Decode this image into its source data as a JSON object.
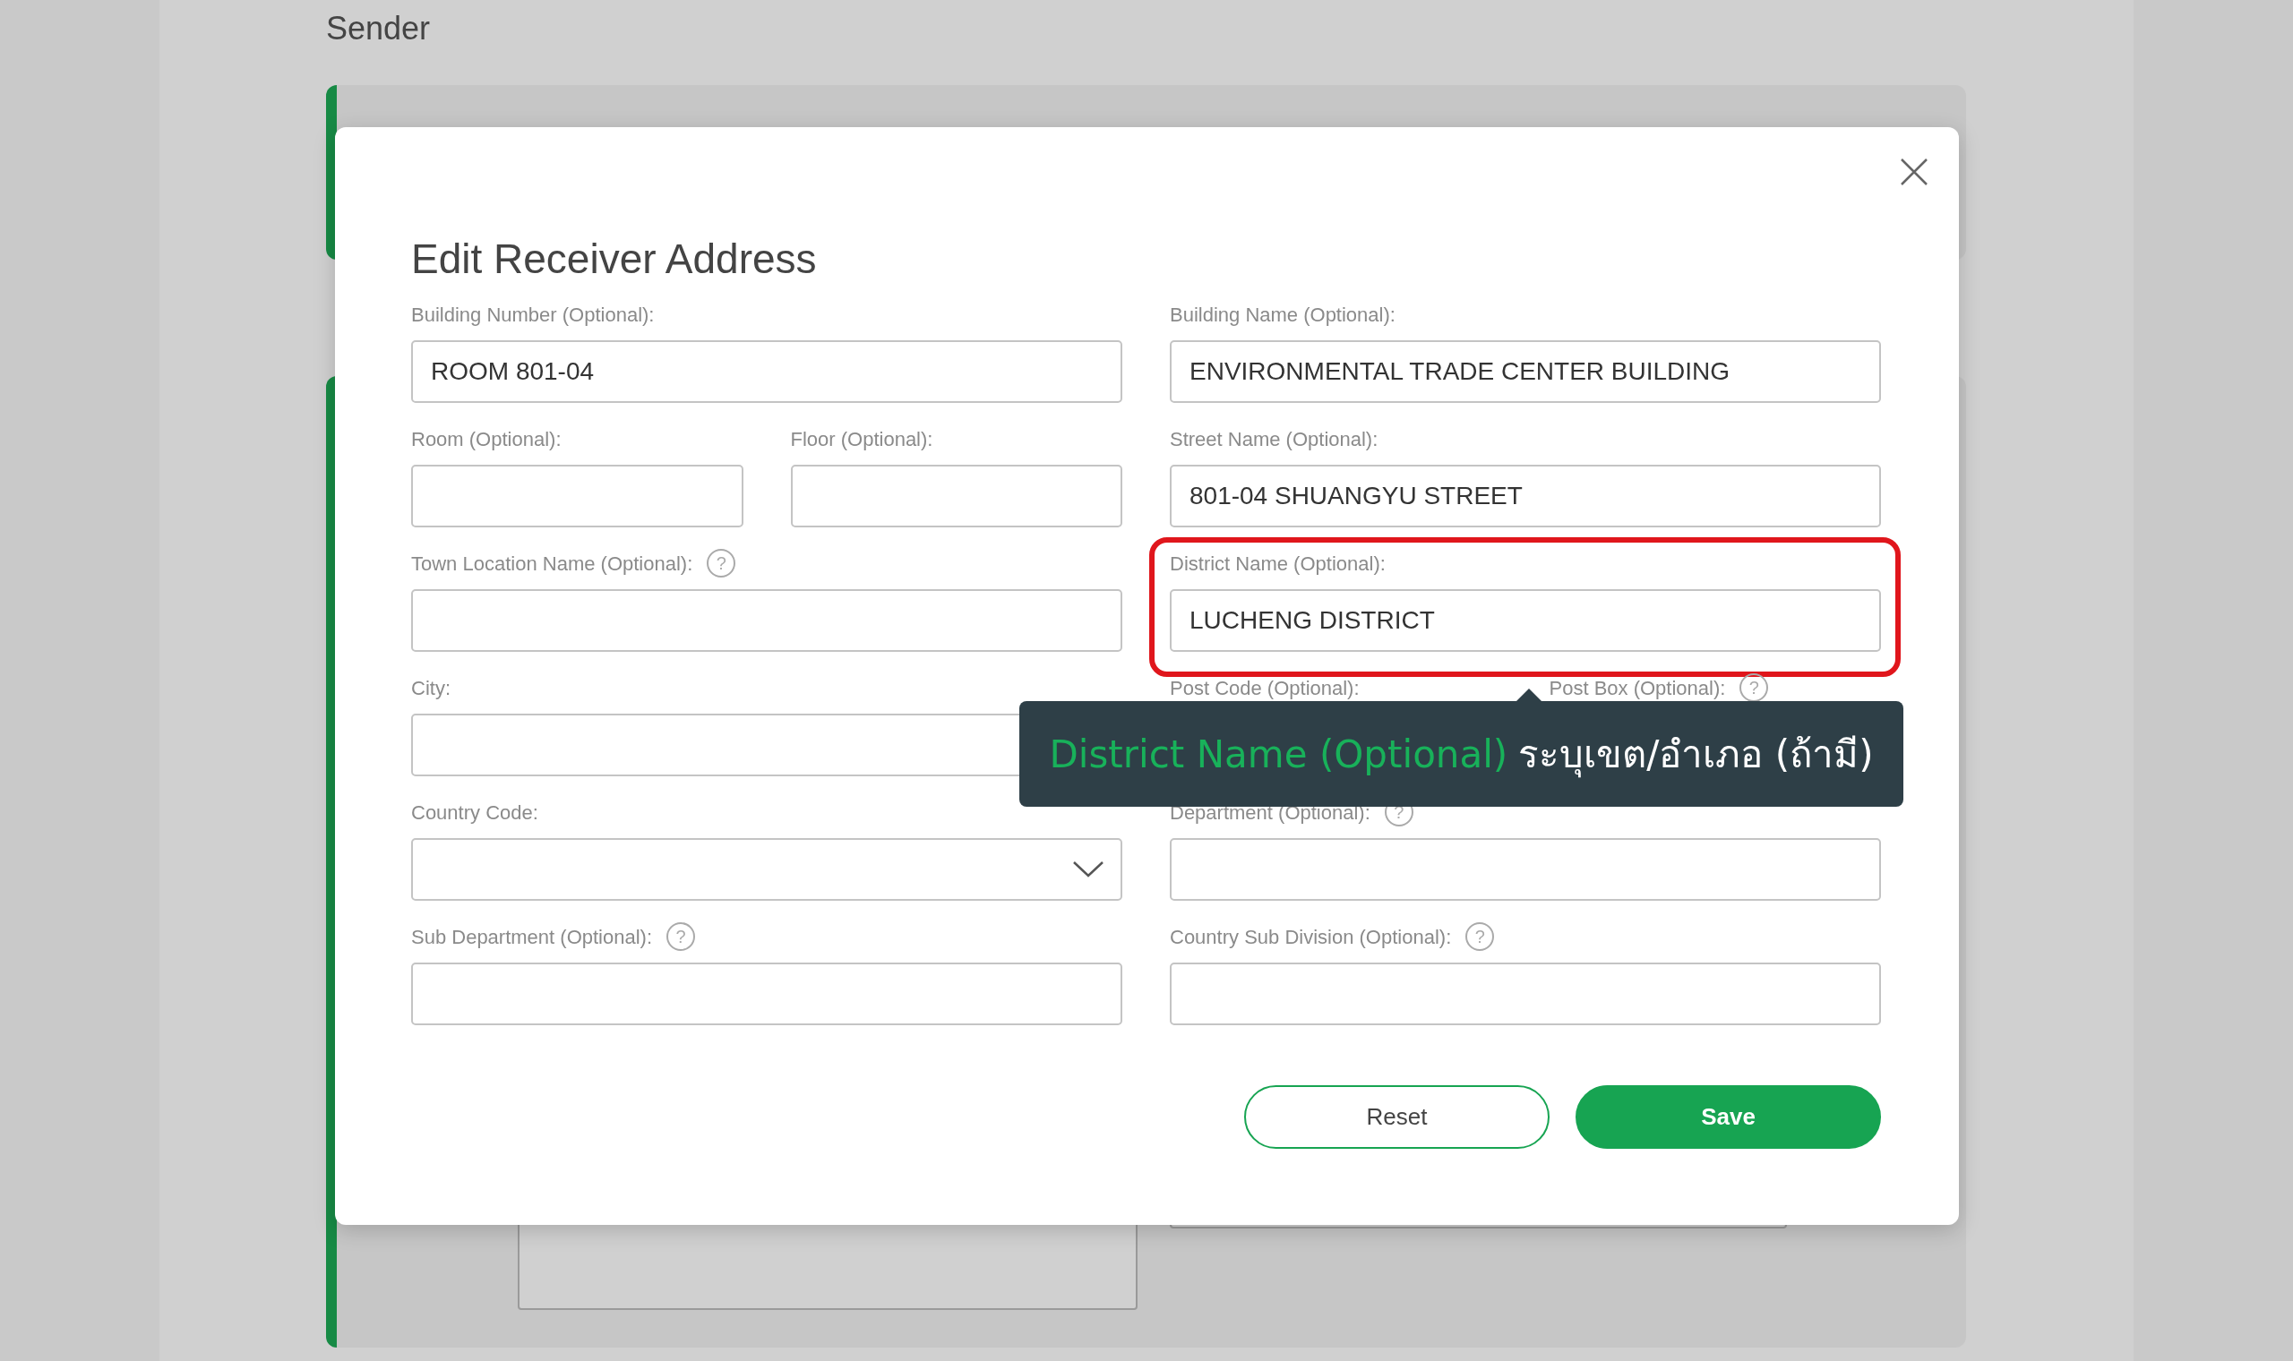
{
  "page": {
    "heading": "Sender"
  },
  "dialog": {
    "title": "Edit Receiver Address",
    "rows": [
      {
        "left": [
          {
            "kind": "text",
            "label": "Building Number (Optional):",
            "value": "ROOM 801-04",
            "highlighted": false
          }
        ],
        "right": [
          {
            "kind": "text",
            "label": "Building Name (Optional):",
            "value": "ENVIRONMENTAL TRADE CENTER BUILDING",
            "highlighted": false
          }
        ]
      },
      {
        "left": [
          {
            "kind": "text",
            "label": "Room (Optional):",
            "highlighted": false
          },
          {
            "kind": "text",
            "label": "Floor (Optional):",
            "highlighted": false
          }
        ],
        "right": [
          {
            "kind": "text",
            "label": "Street Name (Optional):",
            "value": "801-04 SHUANGYU STREET",
            "highlighted": false
          }
        ]
      },
      {
        "left": [
          {
            "kind": "text",
            "label": "Town Location Name (Optional):",
            "help": "?",
            "highlighted": false
          }
        ],
        "right": [
          {
            "kind": "text",
            "label": "District Name (Optional):",
            "value": "LUCHENG DISTRICT",
            "highlighted": true
          }
        ]
      },
      {
        "left": [
          {
            "kind": "text",
            "label": "City:",
            "highlighted": false
          }
        ],
        "right": [
          {
            "kind": "covered",
            "label": "Post Code (Optional):",
            "highlighted": false
          },
          {
            "kind": "covered",
            "label": "Post Box (Optional):",
            "help": "?",
            "highlighted": false
          }
        ]
      },
      {
        "left": [
          {
            "kind": "select",
            "label": "Country Code:",
            "highlighted": false
          }
        ],
        "right": [
          {
            "kind": "text",
            "label": "Department (Optional):",
            "help": "?",
            "highlighted": false
          }
        ]
      },
      {
        "left": [
          {
            "kind": "text",
            "label": "Sub Department (Optional):",
            "help": "?",
            "highlighted": false
          }
        ],
        "right": [
          {
            "kind": "text",
            "label": "Country Sub Division (Optional):",
            "help": "?",
            "highlighted": false
          }
        ]
      }
    ],
    "buttons": [
      {
        "kind": "outline",
        "label": "Reset"
      },
      {
        "kind": "primary",
        "label": "Save"
      }
    ],
    "tooltip": {
      "term": "District Name (Optional)",
      "text": "ระบุเขต/อำเภอ (ถ้ามี)"
    }
  }
}
